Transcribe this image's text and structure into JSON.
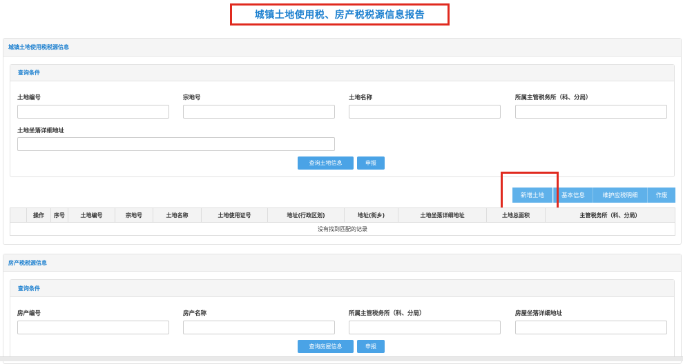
{
  "report_title": "城镇土地使用税、房产税税源信息报告",
  "land_section": {
    "title": "城镇土地使用税税源信息",
    "query_title": "查询条件",
    "fields": {
      "land_no": "土地编号",
      "parcel_no": "宗地号",
      "land_name": "土地名称",
      "tax_office": "所属主管税务所（科、分局）",
      "land_address": "土地坐落详细地址"
    },
    "query_button": "查询土地信息",
    "declare_button": "申报",
    "toolbar": {
      "add": "新增土地",
      "basic_info": "基本信息",
      "maintain": "维护应税明细",
      "void": "作废"
    },
    "table": {
      "columns": [
        "",
        "操作",
        "序号",
        "土地编号",
        "宗地号",
        "土地名称",
        "土地使用证号",
        "地址(行政区划)",
        "地址(街乡)",
        "土地坐落详细地址",
        "土地总面积",
        "主管税务所（科、分局）"
      ],
      "empty_text": "没有找到匹配的记录"
    }
  },
  "house_section": {
    "title": "房产税税源信息",
    "query_title": "查询条件",
    "fields": {
      "house_no": "房产编号",
      "house_name": "房产名称",
      "tax_office": "所属主管税务所（科、分局）",
      "house_address": "房屋坐落详细地址"
    },
    "query_button": "查询房屋信息",
    "declare_button": "申报"
  },
  "colors": {
    "accent": "#1b7fcf",
    "button": "#4aa3e6",
    "highlight": "#e02a1f"
  }
}
